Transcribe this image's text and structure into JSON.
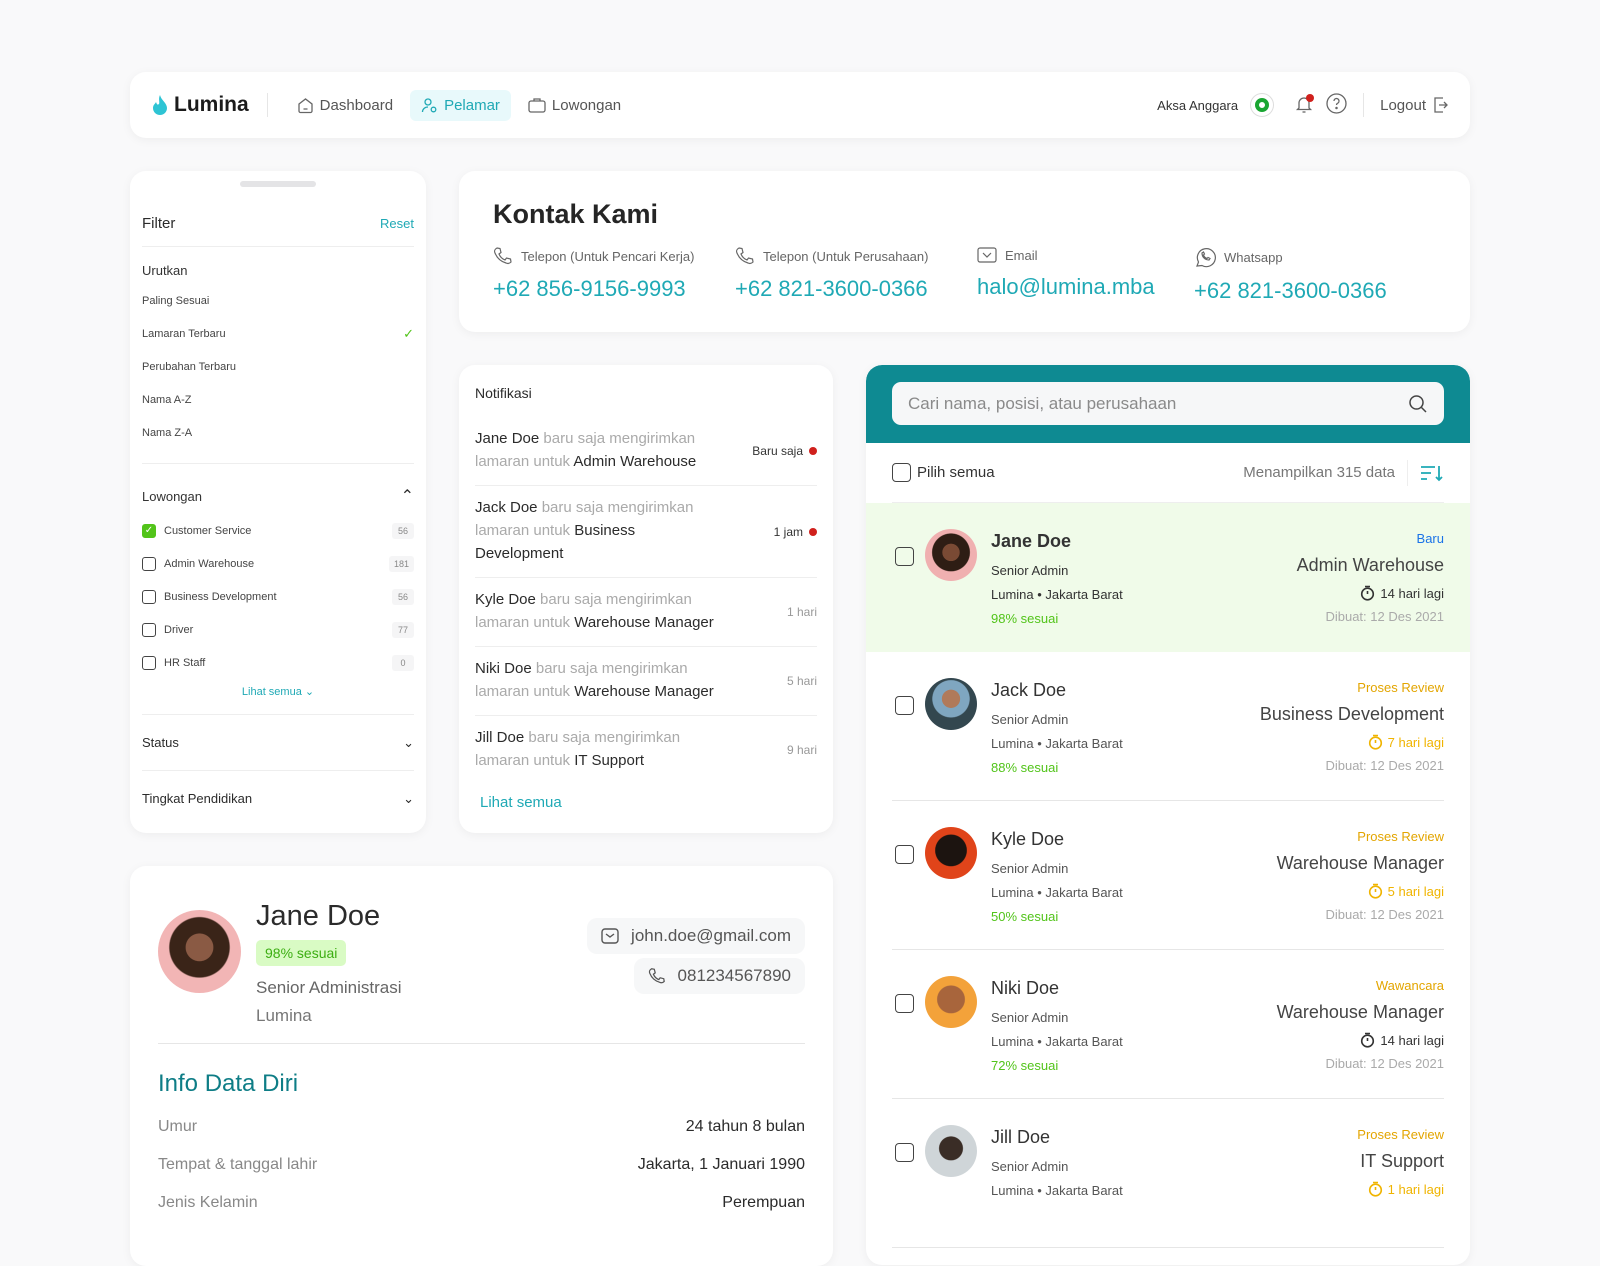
{
  "nav": {
    "brand": "Lumina",
    "items": [
      {
        "label": "Dashboard",
        "icon": "home-icon"
      },
      {
        "label": "Pelamar",
        "icon": "users-icon",
        "active": true
      },
      {
        "label": "Lowongan",
        "icon": "briefcase-icon"
      }
    ],
    "user": "Aksa Anggara",
    "logout": "Logout"
  },
  "filter": {
    "title": "Filter",
    "reset": "Reset",
    "sort_title": "Urutkan",
    "sort": [
      "Paling Sesuai",
      "Lamaran Terbaru",
      "Perubahan Terbaru",
      "Nama A-Z",
      "Nama Z-A"
    ],
    "sort_selected": "Lamaran Terbaru",
    "lowongan_title": "Lowongan",
    "lowongan": [
      {
        "label": "Customer Service",
        "count": "56",
        "checked": true
      },
      {
        "label": "Admin Warehouse",
        "count": "181"
      },
      {
        "label": "Business Development",
        "count": "56"
      },
      {
        "label": "Driver",
        "count": "77"
      },
      {
        "label": "HR Staff",
        "count": "0"
      }
    ],
    "see_all": "Lihat semua",
    "status": "Status",
    "education": "Tingkat Pendidikan"
  },
  "contact": {
    "title": "Kontak Kami",
    "items": [
      {
        "label": "Telepon (Untuk Pencari Kerja)",
        "value": "+62 856-9156-9993"
      },
      {
        "label": "Telepon (Untuk Perusahaan)",
        "value": "+62 821-3600-0366"
      },
      {
        "label": "Email",
        "value": "halo@lumina.mba"
      },
      {
        "label": "Whatsapp",
        "value": "+62 821-3600-0366"
      }
    ]
  },
  "notif": {
    "title": "Notifikasi",
    "middle1": "baru saja mengirimkan",
    "middle2": "lamaran untuk",
    "see_all": "Lihat semua",
    "items": [
      {
        "name": "Jane Doe",
        "job": "Admin Warehouse",
        "time": "Baru saja",
        "unread": true
      },
      {
        "name": "Jack Doe",
        "job": "Business Development",
        "time": "1 jam",
        "unread": true
      },
      {
        "name": "Kyle Doe",
        "job": "Warehouse Manager",
        "time": "1 hari"
      },
      {
        "name": "Niki Doe",
        "job": "Warehouse Manager",
        "time": "5 hari"
      },
      {
        "name": "Jill Doe",
        "job": "IT Support",
        "time": "9 hari"
      }
    ]
  },
  "list": {
    "search_placeholder": "Cari nama, posisi, atau perusahaan",
    "select_all": "Pilih semua",
    "count_text": "Menampilkan 315 data",
    "items": [
      {
        "name": "Jane Doe",
        "role": "Senior Admin",
        "loc": "Lumina • Jakarta Barat",
        "match": "98% sesuai",
        "status": "Baru",
        "status_color": "#1a73e8",
        "job": "Admin Warehouse",
        "deadline": "14 hari lagi",
        "deadline_color": "#333333",
        "created": "Dibuat: 12 Des 2021",
        "highlight": true
      },
      {
        "name": "Jack Doe",
        "role": "Senior Admin",
        "loc": "Lumina • Jakarta Barat",
        "match": "88% sesuai",
        "status": "Proses Review",
        "status_color": "#e3a500",
        "job": "Business Development",
        "deadline": "7 hari lagi",
        "deadline_color": "#f0b400",
        "created": "Dibuat: 12 Des 2021"
      },
      {
        "name": "Kyle Doe",
        "role": "Senior Admin",
        "loc": "Lumina • Jakarta Barat",
        "match": "50% sesuai",
        "status": "Proses Review",
        "status_color": "#e3a500",
        "job": "Warehouse Manager",
        "deadline": "5 hari lagi",
        "deadline_color": "#f0b400",
        "created": "Dibuat: 12 Des 2021"
      },
      {
        "name": "Niki Doe",
        "role": "Senior Admin",
        "loc": "Lumina • Jakarta Barat",
        "match": "72% sesuai",
        "status": "Wawancara",
        "status_color": "#e3a500",
        "job": "Warehouse Manager",
        "deadline": "14 hari lagi",
        "deadline_color": "#333333",
        "created": "Dibuat: 12 Des 2021"
      },
      {
        "name": "Jill Doe",
        "role": "Senior Admin",
        "loc": "Lumina • Jakarta Barat",
        "match": "",
        "status": "Proses Review",
        "status_color": "#e3a500",
        "job": "IT Support",
        "deadline": "1 hari lagi",
        "deadline_color": "#f0b400",
        "created": ""
      }
    ]
  },
  "profile": {
    "name": "Jane Doe",
    "match": "98% sesuai",
    "role": "Senior Administrasi",
    "company": "Lumina",
    "email": "john.doe@gmail.com",
    "phone": "081234567890",
    "section": "Info Data Diri",
    "fields": [
      {
        "k": "Umur",
        "v": "24 tahun 8 bulan"
      },
      {
        "k": "Tempat & tanggal lahir",
        "v": "Jakarta, 1 Januari 1990"
      },
      {
        "k": "Jenis Kelamin",
        "v": "Perempuan"
      }
    ]
  }
}
